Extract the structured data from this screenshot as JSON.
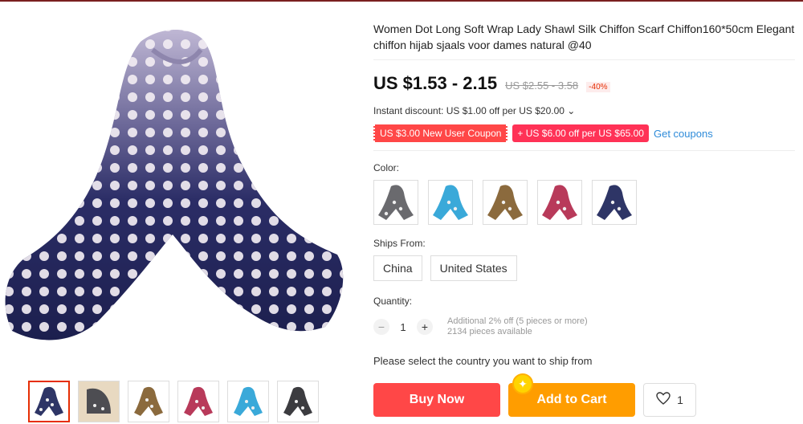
{
  "product": {
    "title": "Women Dot Long Soft Wrap Lady Shawl Silk Chiffon Scarf Chiffon160*50cm Elegant chiffon hijab sjaals voor dames natural @40"
  },
  "price": {
    "current": "US $1.53 - 2.15",
    "original": "US $2.55 - 3.58",
    "discount": "-40%"
  },
  "instant_discount": "Instant discount: US $1.00 off per US $20.00 ⌄",
  "coupons": {
    "new_user": "US $3.00 New User Coupon",
    "store": "+ US $6.00 off per US $65.00",
    "get_label": "Get coupons"
  },
  "color": {
    "label": "Color:",
    "options": [
      {
        "name": "gray",
        "hex": "#5e5e60"
      },
      {
        "name": "sky-blue",
        "hex": "#3aa9d9"
      },
      {
        "name": "khaki",
        "hex": "#8b6a3d"
      },
      {
        "name": "rose",
        "hex": "#b83a5a"
      },
      {
        "name": "navy",
        "hex": "#2e3566"
      }
    ]
  },
  "ships_from": {
    "label": "Ships From:",
    "options": [
      "China",
      "United States"
    ]
  },
  "quantity": {
    "label": "Quantity:",
    "value": "1",
    "minus": "−",
    "plus": "+",
    "info_line1": "Additional 2% off (5 pieces or more)",
    "info_line2": "2134 pieces available"
  },
  "notice": "Please select the country you want to ship from",
  "actions": {
    "buy_now": "Buy Now",
    "add_to_cart": "Add to Cart",
    "wish_count": "1"
  },
  "colors": {
    "accent_red": "#ff4747",
    "accent_orange": "#ff9d00",
    "link_blue": "#2e8bd9"
  }
}
